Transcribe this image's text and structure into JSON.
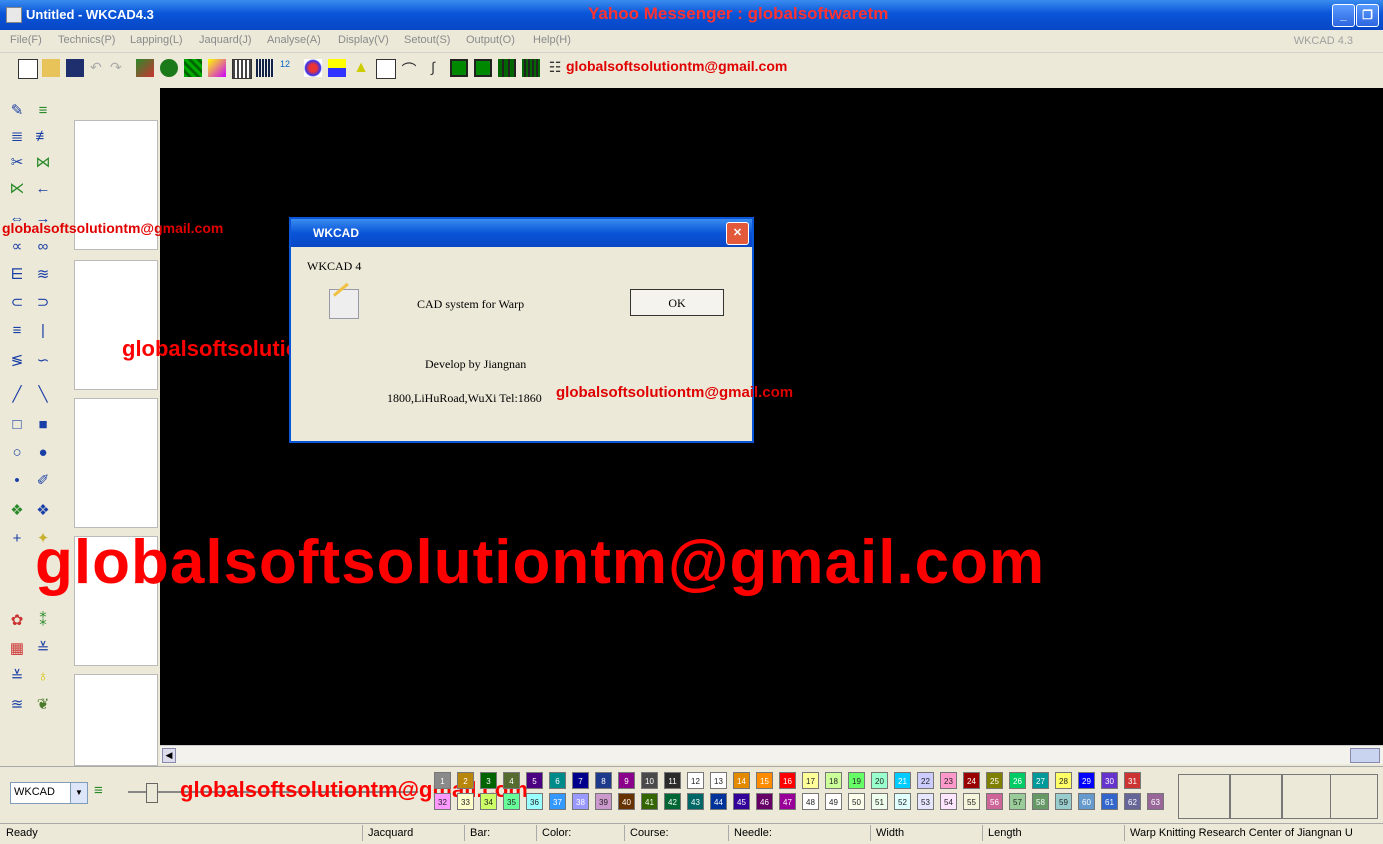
{
  "window": {
    "title": "Untitled - WKCAD4.3",
    "banner": "Yahoo Messenger : globalsoftwaretm",
    "minimize": "_",
    "restore": "❐"
  },
  "menu": {
    "items": [
      "File(F)",
      "Technics(P)",
      "Lapping(L)",
      "Jaquard(J)",
      "Analyse(A)",
      "Display(V)",
      "Setout(S)",
      "Output(O)",
      "Help(H)"
    ],
    "version": "WKCAD 4.3"
  },
  "watermarks": {
    "toolbar": "globalsoftsolutiontm@gmail.com",
    "left": "globalsoftsolutiontm@gmail.com",
    "middle": "globalsoftsolutiontm@gmail.com",
    "dialog_line": "globalsoftsolutiontm@gmail.com",
    "big": "globalsoftsolutiontm@gmail.com",
    "bottom": "globalsoftsolutiontm@gmail.com"
  },
  "dialog": {
    "title": "WKCAD",
    "heading": "WKCAD 4",
    "description": "CAD system for Warp",
    "ok_label": "OK",
    "developer": "Develop by Jiangnan",
    "address": "1800,LiHuRoad,WuXi  Tel:1860"
  },
  "bottom": {
    "combo_value": "WKCAD"
  },
  "palette": {
    "row1": [
      {
        "n": "1",
        "c": "#8a8a8a"
      },
      {
        "n": "2",
        "c": "#b8860b"
      },
      {
        "n": "3",
        "c": "#006400"
      },
      {
        "n": "4",
        "c": "#556b2f"
      },
      {
        "n": "5",
        "c": "#4b0082"
      },
      {
        "n": "6",
        "c": "#008b8b"
      },
      {
        "n": "7",
        "c": "#00008b"
      },
      {
        "n": "8",
        "c": "#1e3a8a"
      },
      {
        "n": "9",
        "c": "#8b008b"
      },
      {
        "n": "10",
        "c": "#4a4a4a"
      },
      {
        "n": "11",
        "c": "#2b2b2b"
      },
      {
        "n": "12",
        "c": "#ffffff"
      },
      {
        "n": "13",
        "c": "#ffffff"
      },
      {
        "n": "14",
        "c": "#e38a00"
      },
      {
        "n": "15",
        "c": "#ff8c00"
      },
      {
        "n": "16",
        "c": "#ff0000"
      },
      {
        "n": "17",
        "c": "#ffff99"
      },
      {
        "n": "18",
        "c": "#ccff99"
      },
      {
        "n": "19",
        "c": "#66ff66"
      },
      {
        "n": "20",
        "c": "#99ffcc"
      },
      {
        "n": "21",
        "c": "#00ccff"
      },
      {
        "n": "22",
        "c": "#ccccff"
      },
      {
        "n": "23",
        "c": "#ff99cc"
      },
      {
        "n": "24",
        "c": "#990000"
      },
      {
        "n": "25",
        "c": "#808000"
      },
      {
        "n": "26",
        "c": "#00cc66"
      },
      {
        "n": "27",
        "c": "#009999"
      },
      {
        "n": "28",
        "c": "#ffff66"
      },
      {
        "n": "29",
        "c": "#0000ff"
      },
      {
        "n": "30",
        "c": "#6633cc"
      },
      {
        "n": "31",
        "c": "#cc3333"
      }
    ],
    "row2": [
      {
        "n": "32",
        "c": "#ff99ff"
      },
      {
        "n": "33",
        "c": "#ffffcc"
      },
      {
        "n": "34",
        "c": "#ccff66"
      },
      {
        "n": "35",
        "c": "#66ff99"
      },
      {
        "n": "36",
        "c": "#99ffff"
      },
      {
        "n": "37",
        "c": "#3399ff"
      },
      {
        "n": "38",
        "c": "#9999ff"
      },
      {
        "n": "39",
        "c": "#cc99cc"
      },
      {
        "n": "40",
        "c": "#663300"
      },
      {
        "n": "41",
        "c": "#336600"
      },
      {
        "n": "42",
        "c": "#006633"
      },
      {
        "n": "43",
        "c": "#006666"
      },
      {
        "n": "44",
        "c": "#003399"
      },
      {
        "n": "45",
        "c": "#330099"
      },
      {
        "n": "46",
        "c": "#660066"
      },
      {
        "n": "47",
        "c": "#990099"
      },
      {
        "n": "48",
        "c": "#ffffff"
      },
      {
        "n": "49",
        "c": "#ffffff"
      },
      {
        "n": "50",
        "c": "#ffffee"
      },
      {
        "n": "51",
        "c": "#eeffee"
      },
      {
        "n": "52",
        "c": "#e0ffff"
      },
      {
        "n": "53",
        "c": "#e6e6ff"
      },
      {
        "n": "54",
        "c": "#ffe6ff"
      },
      {
        "n": "55",
        "c": "#f5f5dc"
      },
      {
        "n": "56",
        "c": "#cc6699"
      },
      {
        "n": "57",
        "c": "#99cc99"
      },
      {
        "n": "58",
        "c": "#669966"
      },
      {
        "n": "59",
        "c": "#99cccc"
      },
      {
        "n": "60",
        "c": "#6699cc"
      },
      {
        "n": "61",
        "c": "#3366cc"
      },
      {
        "n": "62",
        "c": "#666699"
      },
      {
        "n": "63",
        "c": "#996699"
      }
    ]
  },
  "status": {
    "ready": "Ready",
    "mode": "Jacquard",
    "bar": "Bar:",
    "color": "Color:",
    "course": "Course:",
    "needle": "Needle:",
    "width": "Width",
    "length": "Length",
    "org": "Warp Knitting Research Center of Jiangnan U"
  },
  "colors": {
    "title_blue": "#0a55d8",
    "watermark_red": "#ff0000",
    "canvas": "#000000",
    "face": "#ece9d8"
  }
}
